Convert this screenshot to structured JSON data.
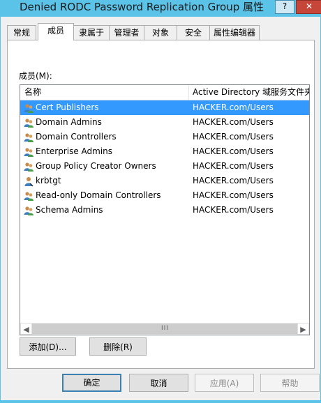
{
  "window": {
    "title": "Denied RODC Password Replication Group 属性",
    "help_label": "?",
    "close_label": "✕"
  },
  "tabs": [
    {
      "label": "常规"
    },
    {
      "label": "成员",
      "active": true
    },
    {
      "label": "隶属于"
    },
    {
      "label": "管理者"
    },
    {
      "label": "对象"
    },
    {
      "label": "安全"
    },
    {
      "label": "属性编辑器"
    }
  ],
  "members": {
    "label": "成员(M):",
    "columns": [
      "名称",
      "Active Directory 域服务文件夹"
    ],
    "rows": [
      {
        "name": "Cert Publishers",
        "folder": "HACKER.com/Users",
        "icon": "group-icon",
        "selected": true
      },
      {
        "name": "Domain Admins",
        "folder": "HACKER.com/Users",
        "icon": "group-icon"
      },
      {
        "name": "Domain Controllers",
        "folder": "HACKER.com/Users",
        "icon": "group-icon"
      },
      {
        "name": "Enterprise Admins",
        "folder": "HACKER.com/Users",
        "icon": "group-icon"
      },
      {
        "name": "Group Policy Creator Owners",
        "folder": "HACKER.com/Users",
        "icon": "group-icon"
      },
      {
        "name": "krbtgt",
        "folder": "HACKER.com/Users",
        "icon": "user-icon"
      },
      {
        "name": "Read-only Domain Controllers",
        "folder": "HACKER.com/Users",
        "icon": "group-icon"
      },
      {
        "name": "Schema Admins",
        "folder": "HACKER.com/Users",
        "icon": "group-icon"
      }
    ],
    "scroll_thumb_grip": "III"
  },
  "actions": {
    "add_label": "添加(D)...",
    "remove_label": "删除(R)"
  },
  "footer": {
    "ok_label": "确定",
    "cancel_label": "取消",
    "apply_label": "应用(A)",
    "help_label": "帮助"
  },
  "colors": {
    "title_bar": "#5cc3e8",
    "selection": "#3399ff",
    "close_button": "#c7463a"
  }
}
